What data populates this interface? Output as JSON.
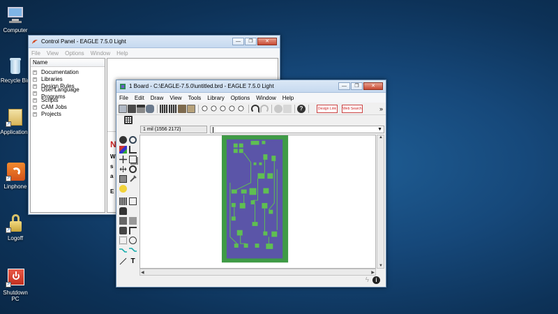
{
  "desktop": {
    "icons": [
      {
        "label": "Computer"
      },
      {
        "label": "Recycle Bin"
      },
      {
        "label": "Applications"
      },
      {
        "label": "Linphone"
      },
      {
        "label": "Logoff"
      },
      {
        "label": "Shutdown PC"
      }
    ]
  },
  "control_panel": {
    "title": "Control Panel - EAGLE 7.5.0 Light",
    "menu": [
      "File",
      "View",
      "Options",
      "Window",
      "Help"
    ],
    "tree_header": "Name",
    "tree_items": [
      "Documentation",
      "Libraries",
      "Design Rules",
      "User Language Programs",
      "Scripts",
      "CAM Jobs",
      "Projects"
    ],
    "fragments": [
      "N",
      "W",
      "s",
      "a",
      "E"
    ]
  },
  "board_window": {
    "title": "1 Board - C:\\EAGLE-7.5.0\\untitled.brd - EAGLE 7.5.0 Light",
    "menu": [
      "File",
      "Edit",
      "Draw",
      "View",
      "Tools",
      "Library",
      "Options",
      "Window",
      "Help"
    ],
    "coordinate": "1 mil (1556 2172)",
    "buttons": {
      "help": "?",
      "more": "»",
      "dropdown": "▼",
      "info": "i",
      "restore_icon": "❐",
      "minimize_icon": "—",
      "close_icon": "✕"
    },
    "logos": [
      {
        "label": "Design Link"
      },
      {
        "label": "Web Search"
      }
    ]
  },
  "colors": {
    "pcb_green": "#3f9b46",
    "pcb_copper": "#5b55a8",
    "pcb_pad": "#5fbf52",
    "desktop_blue": "#16487a"
  }
}
